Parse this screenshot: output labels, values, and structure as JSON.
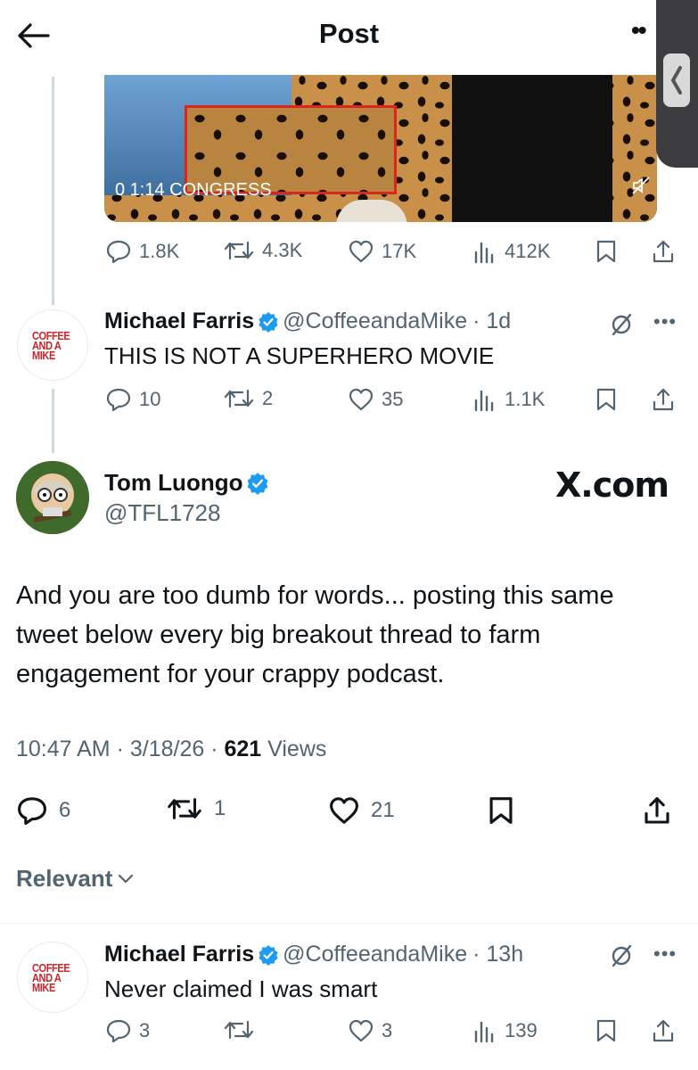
{
  "header": {
    "title": "Post",
    "more": "••"
  },
  "media": {
    "timestamp": "1:14",
    "overlay_text": "0  1:14  CONGRESS"
  },
  "media_actions": {
    "replies": "1.8K",
    "reposts": "4.3K",
    "likes": "17K",
    "views": "412K"
  },
  "reply1": {
    "name": "Michael Farris",
    "handle": "@CoffeeandaMike",
    "time": "· 1d",
    "text": "THIS IS NOT A SUPERHERO MOVIE",
    "avatar_logo": [
      "COFFEE",
      "AND A",
      "MIKE"
    ],
    "actions": {
      "replies": "10",
      "reposts": "2",
      "likes": "35",
      "views": "1.1K"
    }
  },
  "main": {
    "name": "Tom Luongo",
    "handle": "@TFL1728",
    "watermark": "X.com",
    "text": "And you are too dumb for words... posting this same tweet below every big breakout thread to farm engagement for your crappy podcast.",
    "time": "10:47 AM · 3/18/26 · ",
    "views_count": "621",
    "views_label": " Views",
    "actions": {
      "replies": "6",
      "reposts": "1",
      "likes": "21"
    }
  },
  "sort": {
    "label": "Relevant"
  },
  "reply2": {
    "name": "Michael Farris",
    "handle": "@CoffeeandaMike",
    "time": "· 13h",
    "text": "Never claimed I was smart",
    "avatar_logo": [
      "COFFEE",
      "AND A",
      "MIKE"
    ],
    "actions": {
      "replies": "3",
      "reposts": "",
      "likes": "3",
      "views": "139"
    }
  },
  "colors": {
    "accent": "#1d9bf0",
    "text": "#0f1419",
    "muted": "#536471",
    "logo_red": "#c9262b"
  }
}
